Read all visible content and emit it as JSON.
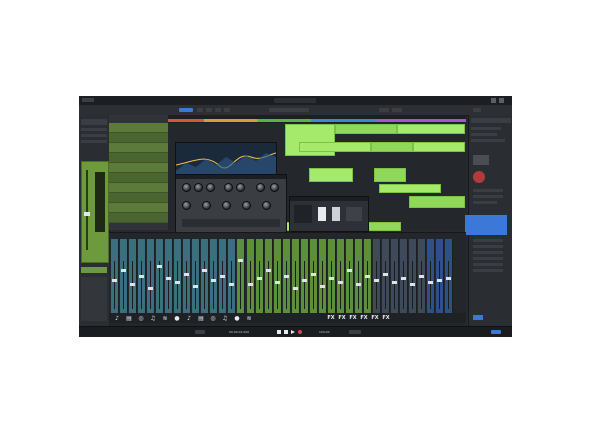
{
  "app": {
    "title": "Studio One",
    "accent": "#a6ea6c",
    "track_green": "#5c7a3a",
    "mixer_teal": "#3b6f7e",
    "selection_blue": "#3b78d8"
  },
  "transport": {
    "time": "00:00:01.000",
    "tempo": "120.00"
  },
  "mixer": {
    "fx_label": "FX"
  },
  "icons": {
    "channel_icons": [
      "guitar-icon",
      "piano-icon",
      "drum-icon",
      "bass-icon",
      "synth-icon",
      "mic-icon",
      "guitar-icon",
      "piano-icon",
      "drum-icon",
      "bass-icon",
      "mic-icon",
      "synth-icon"
    ]
  }
}
